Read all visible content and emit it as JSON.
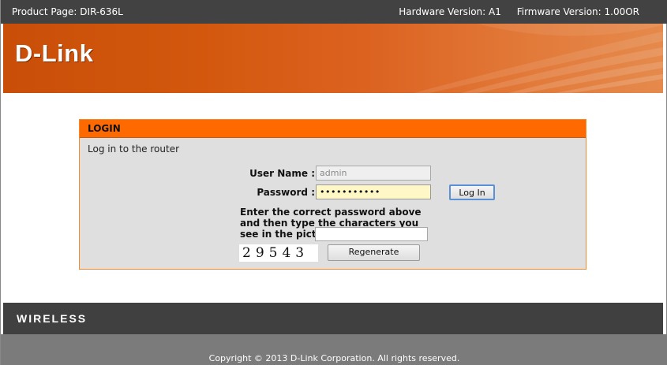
{
  "header": {
    "product_page": "Product Page: DIR-636L",
    "hardware_version": "Hardware Version: A1",
    "firmware_version": "Firmware Version: 1.00OR"
  },
  "banner": {
    "logo_text": "D-Link"
  },
  "login": {
    "title": "LOGIN",
    "subtitle": "Log in to the router",
    "username_label": "User Name :",
    "username_value": "admin",
    "password_label": "Password :",
    "password_value": "•••••••••••",
    "login_button": "Log In",
    "instructions": "Enter the correct password above and then type the characters you see in the picture below.",
    "captcha_input_value": "",
    "captcha_text": "29543",
    "regenerate_button": "Regenerate"
  },
  "footer": {
    "wireless_label": "WIRELESS",
    "copyright": "Copyright © 2013 D-Link Corporation. All rights reserved."
  },
  "colors": {
    "header_bg": "#424242",
    "banner_orange": "#d3580e",
    "login_title_bg": "#ff6a00",
    "login_panel_bg": "#dfdfdf",
    "password_field_bg": "#fff8c6",
    "footer_bg": "#404040",
    "bottom_bg": "#7b7b7b"
  }
}
